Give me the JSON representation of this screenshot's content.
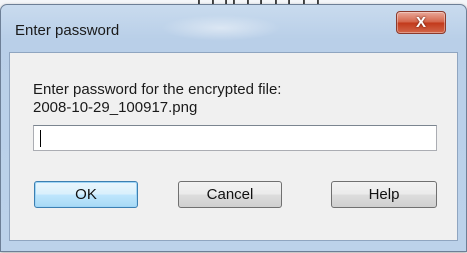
{
  "background": {
    "toolbar_glyphs": "] ] [] ] [ ] [ ] ]"
  },
  "dialog": {
    "title": "Enter password",
    "close_glyph": "X",
    "prompt": "Enter password for the encrypted file:",
    "filename": "2008-10-29_100917.png",
    "password_value": "",
    "buttons": {
      "ok": "OK",
      "cancel": "Cancel",
      "help": "Help"
    }
  },
  "colors": {
    "frame": "#b9cfe8",
    "close_button": "#c2391b",
    "default_button_border": "#3c7fb1",
    "client_bg": "#f0f0f0"
  }
}
